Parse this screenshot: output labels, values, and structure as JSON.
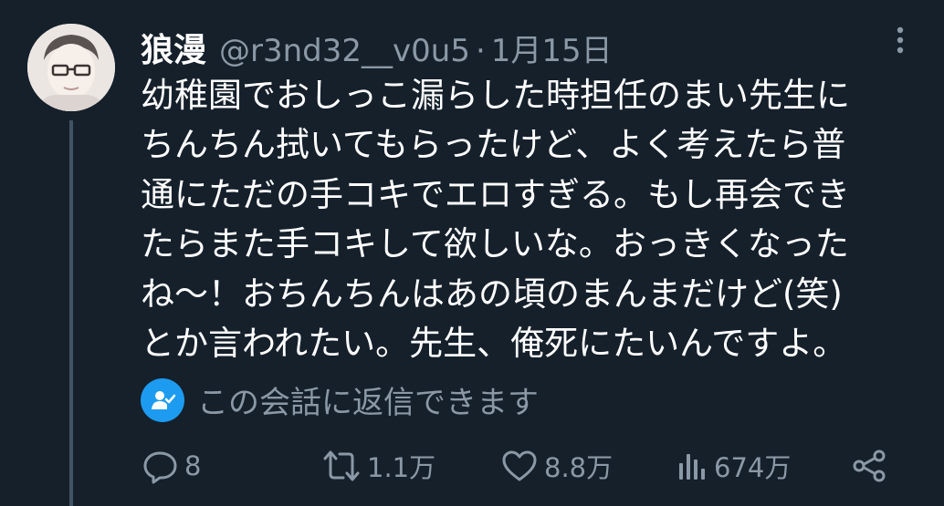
{
  "tweet": {
    "display_name": "狼漫",
    "handle": "@r3nd32__v0u5",
    "separator": "·",
    "date": "1月15日",
    "lines": [
      "幼稚園でおしっこ漏らした時担任のまい先生に",
      "ちんちん拭いてもらったけど、よく考えたら普",
      "通にただの手コキでエロすぎる。もし再会でき",
      "たらまた手コキして欲しいな。おっきくなった",
      "ね〜！おちんちんはあの頃のまんまだけど(笑)",
      "とか言われたい。先生、俺死にたいんですよ。"
    ]
  },
  "reply_notice": {
    "icon": "person-check-icon",
    "text": "この会話に返信できます"
  },
  "actions": {
    "reply": {
      "icon": "reply-icon",
      "count": "8"
    },
    "retweet": {
      "icon": "retweet-icon",
      "count": "1.1万"
    },
    "like": {
      "icon": "heart-icon",
      "count": "8.8万"
    },
    "views": {
      "icon": "views-icon",
      "count": "674万"
    },
    "share": {
      "icon": "share-icon"
    }
  },
  "colors": {
    "background": "#15202b",
    "text": "#ffffff",
    "secondary": "#8b98a5",
    "accent": "#1d9bf0",
    "thread_line": "#425364"
  }
}
